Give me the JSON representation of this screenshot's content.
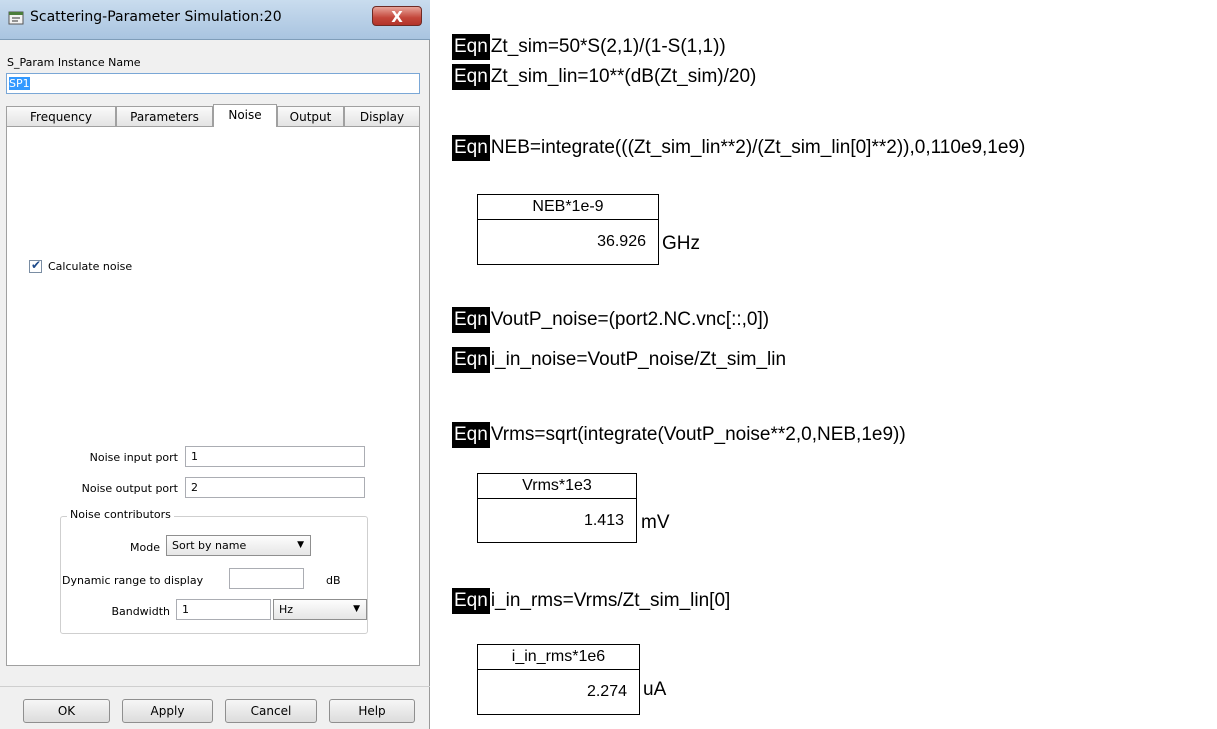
{
  "dialog": {
    "title": "Scattering-Parameter Simulation:20",
    "close_label": "X",
    "instance_label": "S_Param Instance Name",
    "instance_value": "SP1",
    "tabs": [
      "Frequency",
      "Parameters",
      "Noise",
      "Output",
      "Display"
    ],
    "active_tab": "Noise",
    "calc_noise_label": "Calculate noise",
    "calc_noise_checked": true,
    "noise_input_port_label": "Noise input port",
    "noise_input_port_value": "1",
    "noise_output_port_label": "Noise output port",
    "noise_output_port_value": "2",
    "contributors_legend": "Noise contributors",
    "mode_label": "Mode",
    "mode_value": "Sort by name",
    "dyn_range_label": "Dynamic range to display",
    "dyn_range_value": "",
    "dyn_range_unit": "dB",
    "bandwidth_label": "Bandwidth",
    "bandwidth_value": "1",
    "bandwidth_unit": "Hz",
    "buttons": {
      "ok": "OK",
      "apply": "Apply",
      "cancel": "Cancel",
      "help": "Help"
    }
  },
  "equations": {
    "tag": "Eqn",
    "zt_sim": "Zt_sim=50*S(2,1)/(1-S(1,1))",
    "zt_sim_lin": "Zt_sim_lin=10**(dB(Zt_sim)/20)",
    "neb": "NEB=integrate(((Zt_sim_lin**2)/(Zt_sim_lin[0]**2)),0,110e9,1e9)",
    "voutp_noise": "VoutP_noise=(port2.NC.vnc[::,0])",
    "i_in_noise": "i_in_noise=VoutP_noise/Zt_sim_lin",
    "vrms": "Vrms=sqrt(integrate(VoutP_noise**2,0,NEB,1e9))",
    "i_in_rms": "i_in_rms=Vrms/Zt_sim_lin[0]"
  },
  "results": {
    "neb": {
      "header": "NEB*1e-9",
      "value": "36.926",
      "unit": "GHz"
    },
    "vrms": {
      "header": "Vrms*1e3",
      "value": "1.413",
      "unit": "mV"
    },
    "i_in_rms": {
      "header": "i_in_rms*1e6",
      "value": "2.274",
      "unit": "uA"
    }
  }
}
